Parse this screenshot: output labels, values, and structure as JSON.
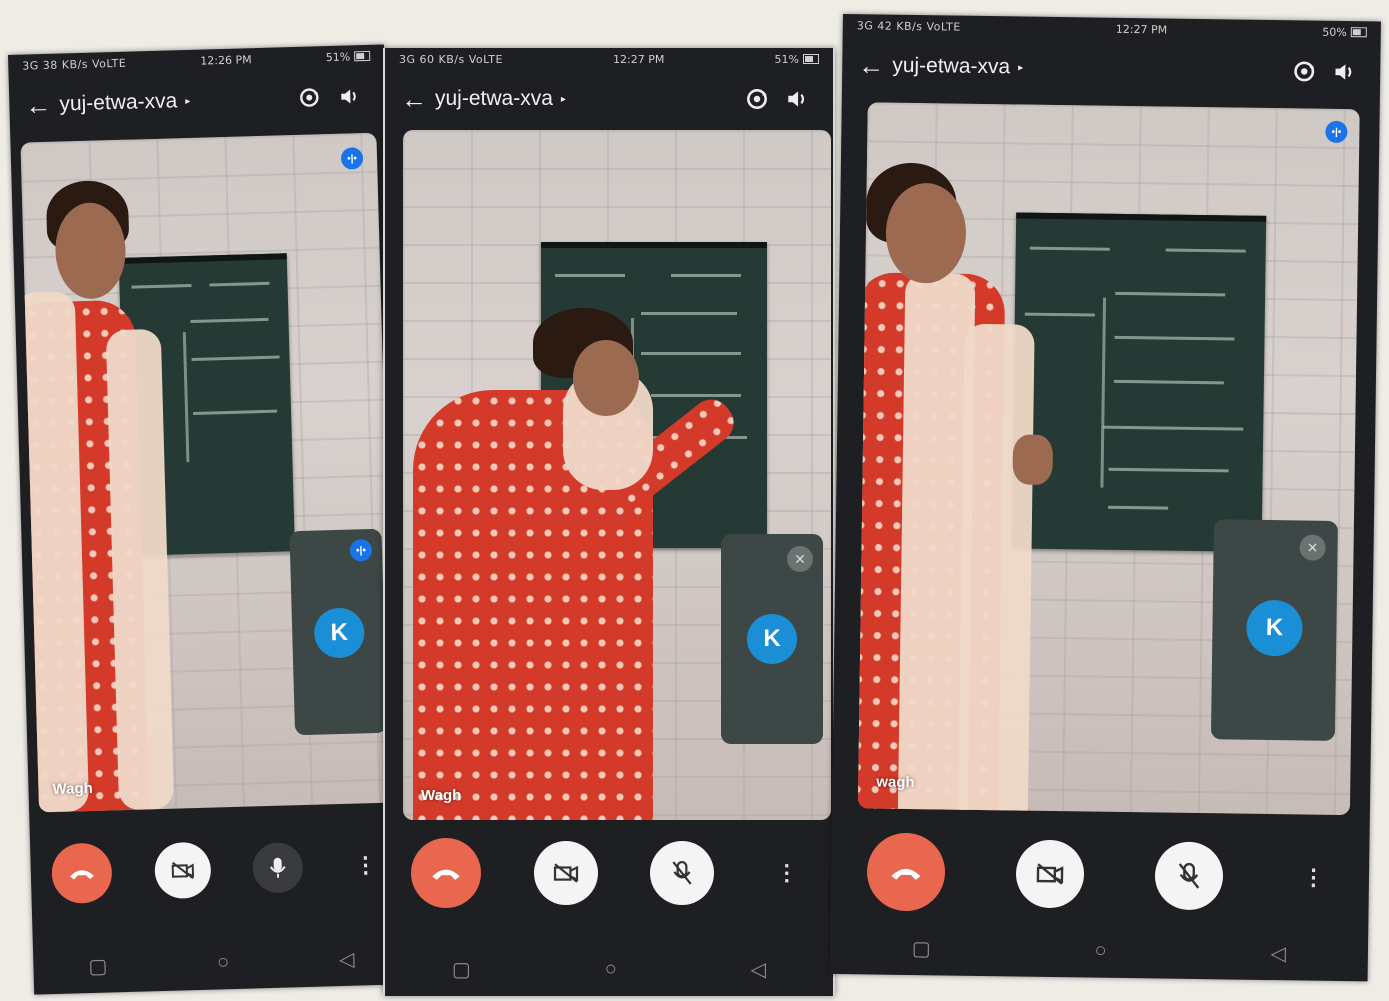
{
  "screenshots": [
    {
      "status": {
        "network": "3G 38 KB/s VoLTE",
        "time": "12:26 PM",
        "battery": "51%"
      },
      "meeting_code": "yuj-etwa-xva",
      "participant_name": "Wagh",
      "self_initial": "K",
      "self_muted": false,
      "controls": [
        "end-call",
        "camera-off",
        "microphone",
        "more-options"
      ]
    },
    {
      "status": {
        "network": "3G 60 KB/s VoLTE",
        "time": "12:27 PM",
        "battery": "51%"
      },
      "meeting_code": "yuj-etwa-xva",
      "participant_name": "Wagh",
      "self_initial": "K",
      "self_muted": true,
      "controls": [
        "end-call",
        "camera-off",
        "microphone-off",
        "more-options"
      ]
    },
    {
      "status": {
        "network": "3G 42 KB/s VoLTE",
        "time": "12:27 PM",
        "battery": "50%"
      },
      "meeting_code": "yuj-etwa-xva",
      "participant_name": "wagh",
      "self_initial": "K",
      "self_muted": true,
      "controls": [
        "end-call",
        "camera-off",
        "microphone-off",
        "more-options"
      ]
    }
  ],
  "icons": {
    "back": "←",
    "caret": "▸",
    "switch_camera": "⟳",
    "speaker": "🔈",
    "end_call": "☎",
    "camera_off": "▧",
    "mic": "🎤",
    "mic_off": "✕",
    "more": "⋮",
    "nav_recent": "▢",
    "nav_home": "○",
    "nav_back": "◁",
    "speaking": "•|•"
  },
  "colors": {
    "end_call": "#e8674e",
    "avatar": "#1b8fd6",
    "speaking_badge": "#1a73e8",
    "dress": "#d33a2a",
    "blackboard": "#253a34"
  }
}
